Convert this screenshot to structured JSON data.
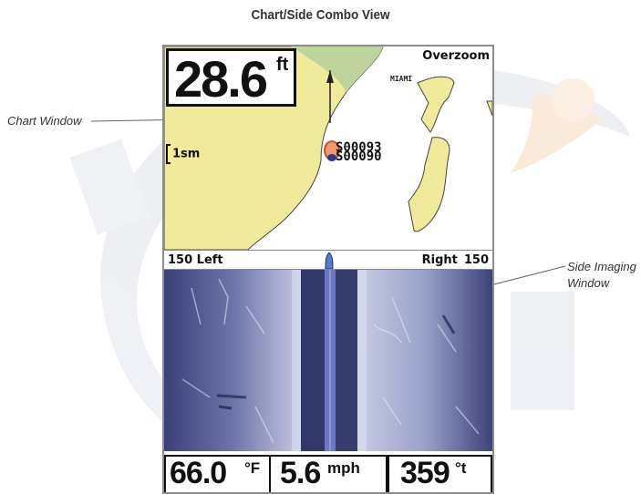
{
  "page_title": "Chart/Side Combo View",
  "callouts": {
    "chart_window": "Chart Window",
    "side_imaging_line1": "Side Imaging",
    "side_imaging_line2": "Window"
  },
  "chart": {
    "depth_value": "28.6",
    "depth_unit": "ft",
    "zoom_status": "Overzoom",
    "city_label": "MIAMI",
    "scale_label": "1sm",
    "waypoint_label_1": "S00093",
    "waypoint_label_2": "S00090",
    "colors": {
      "land": "#f0eb9b",
      "shallow": "#bfd49a",
      "water": "#ffffff"
    }
  },
  "side_imaging": {
    "left_label": "150 Left",
    "right_word": "Right",
    "right_value": "150",
    "colors": {
      "sonar_blue": "#4a528f",
      "sonar_light": "#b9bfdd",
      "center_strip": "#6e78c0"
    }
  },
  "digital_readouts": [
    {
      "value": "66.0",
      "unit": "°F"
    },
    {
      "value": "5.6",
      "unit": "mph"
    },
    {
      "value": "359",
      "unit": "°t"
    }
  ]
}
